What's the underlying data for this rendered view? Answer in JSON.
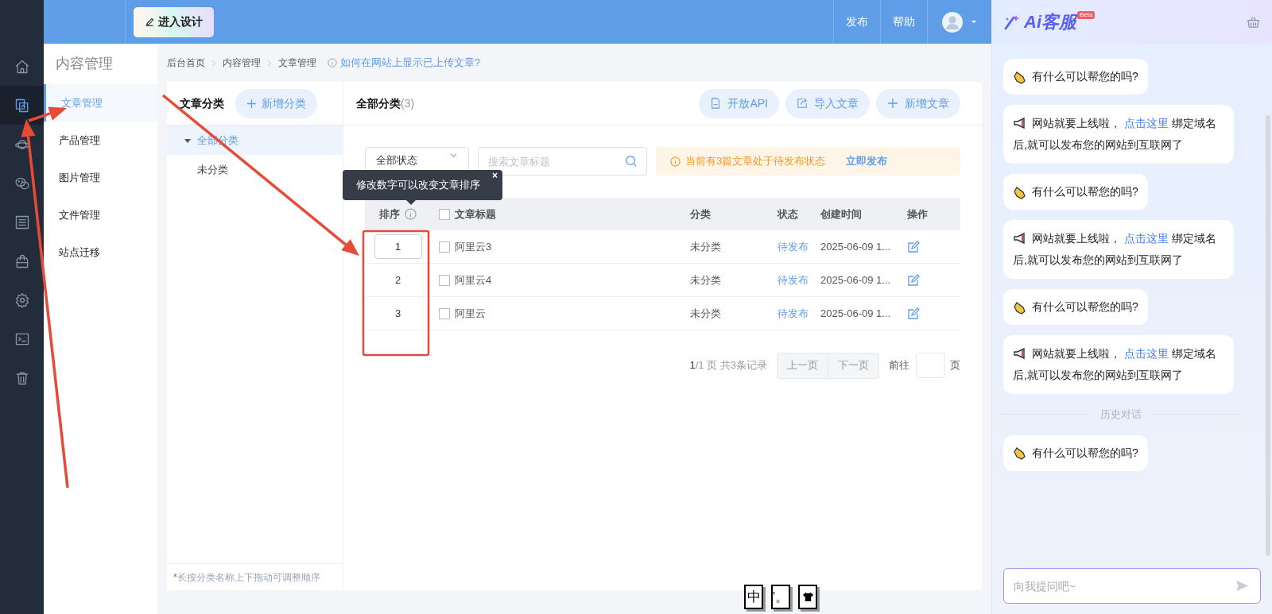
{
  "topbar": {
    "design_button": "进入设计",
    "actions": [
      "发布",
      "帮助"
    ]
  },
  "rail": [
    {
      "selected": false
    },
    {
      "selected": true
    },
    {
      "selected": false
    },
    {
      "selected": false
    },
    {
      "selected": false
    },
    {
      "selected": false
    },
    {
      "selected": false
    },
    {
      "selected": false
    },
    {
      "selected": false
    }
  ],
  "sidebar": {
    "title": "内容管理",
    "items": [
      {
        "label": "文章管理",
        "selected": true
      },
      {
        "label": "产品管理",
        "selected": false
      },
      {
        "label": "图片管理",
        "selected": false
      },
      {
        "label": "文件管理",
        "selected": false
      },
      {
        "label": "站点迁移",
        "selected": false
      }
    ]
  },
  "breadcrumb": [
    "后台首页",
    "内容管理",
    "文章管理"
  ],
  "help_link": "如何在网站上显示已上传文章?",
  "categories": {
    "title": "文章分类",
    "add_button": "新增分类",
    "tree": [
      {
        "label": "全部分类",
        "selected": true,
        "expanded": true,
        "children": [
          {
            "label": "未分类",
            "selected": false
          }
        ]
      }
    ],
    "note_marker": "*",
    "note": "长按分类名称上下拖动可调整顺序"
  },
  "articles": {
    "title": "全部分类",
    "count": "(3)",
    "buttons": [
      {
        "kind": "api",
        "label": "开放API"
      },
      {
        "kind": "import",
        "label": "导入文章"
      },
      {
        "kind": "add",
        "label": "新增文章"
      }
    ],
    "status_filter": "全部状态",
    "search": {
      "placeholder": "搜索文章标题"
    },
    "alert": {
      "text": "当前有3篇文章处于待发布状态",
      "action": "立即发布"
    },
    "tooltip": {
      "text": "修改数字可以改变文章排序",
      "close": "×"
    },
    "columns": [
      "排序",
      "文章标题",
      "分类",
      "状态",
      "创建时间",
      "操作"
    ],
    "select_all_checked": false,
    "rows": [
      {
        "order": "1",
        "editing": true,
        "checked": false,
        "title": "阿里云3",
        "category": "未分类",
        "status": "待发布",
        "created": "2025-06-09 1..."
      },
      {
        "order": "2",
        "editing": false,
        "checked": false,
        "title": "阿里云4",
        "category": "未分类",
        "status": "待发布",
        "created": "2025-06-09 1..."
      },
      {
        "order": "3",
        "editing": false,
        "checked": false,
        "title": "阿里云",
        "category": "未分类",
        "status": "待发布",
        "created": "2025-06-09 1..."
      }
    ],
    "pagination": {
      "page": "1",
      "info": "/1 页 共3条记录",
      "prev": "上一页",
      "next": "下一页",
      "goto": "前往",
      "unit": "页"
    }
  },
  "chat": {
    "logo": "Ai客服",
    "badge": "Beta",
    "messages": [
      {
        "kind": "greeting",
        "text": "有什么可以帮您的吗?"
      },
      {
        "kind": "notice",
        "before": "网站就要上线啦，",
        "link": "点击这里",
        "after": "绑定域名后,就可以发布您的网站到互联网了"
      },
      {
        "kind": "greeting",
        "text": "有什么可以帮您的吗?"
      },
      {
        "kind": "notice",
        "before": "网站就要上线啦，",
        "link": "点击这里",
        "after": "绑定域名后,就可以发布您的网站到互联网了"
      },
      {
        "kind": "greeting",
        "text": "有什么可以帮您的吗?"
      },
      {
        "kind": "notice",
        "before": "网站就要上线啦，",
        "link": "点击这里",
        "after": "绑定域名后,就可以发布您的网站到互联网了"
      },
      {
        "kind": "divider",
        "text": "历史对话"
      },
      {
        "kind": "greeting",
        "text": "有什么可以帮您的吗?"
      }
    ],
    "input": {
      "placeholder": "向我提问吧~"
    }
  },
  "ime_toolbar": [
    "中",
    "’。"
  ]
}
